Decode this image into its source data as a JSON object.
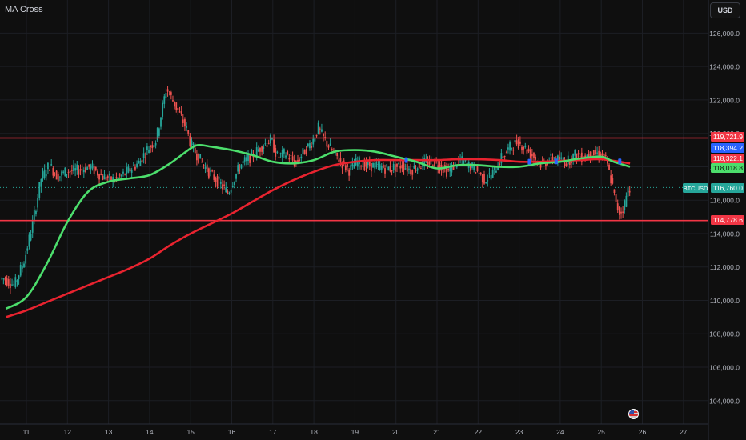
{
  "header": {
    "indicator_title": "MA Cross",
    "currency_label": "USD"
  },
  "colors": {
    "background": "#0f0f0f",
    "candle_up": "#26a69a",
    "candle_down": "#ef5350",
    "ma_fast": "#4cde6c",
    "ma_slow": "#e8232f",
    "level_line": "#f23645",
    "cross_marker": "#2962ff"
  },
  "chart_data": {
    "type": "candlestick",
    "symbol": "BTCUSD",
    "y_axis": {
      "range": [
        102600,
        127600
      ],
      "ticks": [
        104000,
        106000,
        108000,
        110000,
        112000,
        114000,
        116000,
        118000,
        120000,
        122000,
        124000,
        126000
      ],
      "tick_labels": [
        "104,000.0",
        "106,000.0",
        "108,000.0",
        "110,000.0",
        "112,000.0",
        "114,000.0",
        "116,000.0",
        "118,000.0",
        "120,000.0",
        "122,000.0",
        "124,000.0",
        "126,000.0"
      ]
    },
    "x_axis": {
      "ticks": [
        "11",
        "12",
        "13",
        "14",
        "15",
        "16",
        "17",
        "18",
        "19",
        "20",
        "21",
        "22",
        "23",
        "24",
        "25",
        "26",
        "27"
      ]
    },
    "horizontal_levels": [
      119721.9,
      114778.6
    ],
    "price_labels": [
      {
        "text": "119,721.9",
        "value": 119721.9,
        "color": "#f23645"
      },
      {
        "text": "118,394.2",
        "value": 118394.2,
        "color": "#2962ff"
      },
      {
        "text": "118,322.1",
        "value": 118322.1,
        "color": "#f23645"
      },
      {
        "text": "118,018.8",
        "value": 118018.8,
        "color": "#4cde6c"
      },
      {
        "text": "116,760.0",
        "value": 116760.0,
        "color": "#26a69a"
      },
      {
        "text": "114,778.6",
        "value": 114778.6,
        "color": "#f23645"
      }
    ],
    "last_price_label": "BTCUSD",
    "last_price": 116760.0,
    "price_path": [
      [
        10.5,
        111300
      ],
      [
        10.75,
        110900
      ],
      [
        11.0,
        112500
      ],
      [
        11.2,
        114700
      ],
      [
        11.4,
        117300
      ],
      [
        11.6,
        118100
      ],
      [
        11.8,
        117400
      ],
      [
        12.0,
        117700
      ],
      [
        12.3,
        117800
      ],
      [
        12.6,
        118000
      ],
      [
        12.9,
        117400
      ],
      [
        13.2,
        117200
      ],
      [
        13.5,
        117700
      ],
      [
        13.8,
        118300
      ],
      [
        14.0,
        119100
      ],
      [
        14.2,
        119600
      ],
      [
        14.35,
        121500
      ],
      [
        14.45,
        122700
      ],
      [
        14.6,
        122000
      ],
      [
        14.8,
        121000
      ],
      [
        14.95,
        120200
      ],
      [
        15.05,
        119300
      ],
      [
        15.2,
        118700
      ],
      [
        15.35,
        118100
      ],
      [
        15.55,
        117500
      ],
      [
        15.75,
        117000
      ],
      [
        15.95,
        116400
      ],
      [
        16.1,
        117300
      ],
      [
        16.25,
        118100
      ],
      [
        16.4,
        118400
      ],
      [
        16.6,
        118800
      ],
      [
        16.8,
        119300
      ],
      [
        17.0,
        119600
      ],
      [
        17.15,
        118600
      ],
      [
        17.35,
        118800
      ],
      [
        17.6,
        118200
      ],
      [
        17.8,
        118900
      ],
      [
        18.0,
        119500
      ],
      [
        18.15,
        120300
      ],
      [
        18.3,
        119600
      ],
      [
        18.5,
        118900
      ],
      [
        18.7,
        118300
      ],
      [
        18.9,
        117800
      ],
      [
        19.1,
        118300
      ],
      [
        19.3,
        118100
      ],
      [
        19.6,
        118000
      ],
      [
        19.9,
        117900
      ],
      [
        20.2,
        118100
      ],
      [
        20.4,
        117800
      ],
      [
        20.7,
        118200
      ],
      [
        21.0,
        118300
      ],
      [
        21.3,
        117700
      ],
      [
        21.6,
        118400
      ],
      [
        21.8,
        118100
      ],
      [
        22.0,
        117800
      ],
      [
        22.2,
        117200
      ],
      [
        22.4,
        117600
      ],
      [
        22.6,
        118500
      ],
      [
        22.8,
        119100
      ],
      [
        23.0,
        119500
      ],
      [
        23.2,
        119100
      ],
      [
        23.4,
        118600
      ],
      [
        23.6,
        118100
      ],
      [
        23.8,
        118500
      ],
      [
        24.0,
        118400
      ],
      [
        24.2,
        118300
      ],
      [
        24.4,
        118700
      ],
      [
        24.6,
        118600
      ],
      [
        24.8,
        118800
      ],
      [
        25.0,
        118800
      ],
      [
        25.15,
        118400
      ],
      [
        25.3,
        117000
      ],
      [
        25.4,
        115700
      ],
      [
        25.5,
        115200
      ],
      [
        25.6,
        115700
      ],
      [
        25.7,
        116760
      ]
    ],
    "series": [
      {
        "name": "MA fast",
        "points": [
          [
            10.5,
            109500
          ],
          [
            11.0,
            110200
          ],
          [
            11.5,
            112200
          ],
          [
            12.0,
            114700
          ],
          [
            12.5,
            116500
          ],
          [
            13.0,
            117100
          ],
          [
            13.5,
            117300
          ],
          [
            14.0,
            117500
          ],
          [
            14.5,
            118200
          ],
          [
            15.0,
            119100
          ],
          [
            15.2,
            119300
          ],
          [
            15.5,
            119200
          ],
          [
            16.0,
            119000
          ],
          [
            16.5,
            118700
          ],
          [
            17.0,
            118300
          ],
          [
            17.5,
            118200
          ],
          [
            18.0,
            118400
          ],
          [
            18.5,
            118900
          ],
          [
            19.0,
            119000
          ],
          [
            19.5,
            118900
          ],
          [
            20.0,
            118600
          ],
          [
            20.5,
            118300
          ],
          [
            21.0,
            117900
          ],
          [
            21.5,
            118100
          ],
          [
            22.0,
            118100
          ],
          [
            22.5,
            118000
          ],
          [
            23.0,
            118000
          ],
          [
            23.5,
            118200
          ],
          [
            24.0,
            118300
          ],
          [
            24.5,
            118500
          ],
          [
            25.0,
            118600
          ],
          [
            25.3,
            118300
          ],
          [
            25.7,
            118000
          ]
        ]
      },
      {
        "name": "MA slow",
        "points": [
          [
            10.5,
            109000
          ],
          [
            11.0,
            109400
          ],
          [
            11.5,
            109900
          ],
          [
            12.0,
            110400
          ],
          [
            12.5,
            110900
          ],
          [
            13.0,
            111400
          ],
          [
            13.5,
            111900
          ],
          [
            14.0,
            112500
          ],
          [
            14.5,
            113300
          ],
          [
            15.0,
            114000
          ],
          [
            15.5,
            114600
          ],
          [
            16.0,
            115200
          ],
          [
            16.5,
            115900
          ],
          [
            17.0,
            116600
          ],
          [
            17.5,
            117200
          ],
          [
            18.0,
            117700
          ],
          [
            18.5,
            118100
          ],
          [
            19.0,
            118300
          ],
          [
            19.5,
            118400
          ],
          [
            20.0,
            118400
          ],
          [
            20.5,
            118400
          ],
          [
            21.0,
            118400
          ],
          [
            21.5,
            118450
          ],
          [
            22.0,
            118450
          ],
          [
            22.5,
            118400
          ],
          [
            23.0,
            118300
          ],
          [
            23.5,
            118300
          ],
          [
            24.0,
            118350
          ],
          [
            24.5,
            118400
          ],
          [
            25.0,
            118450
          ],
          [
            25.7,
            118200
          ]
        ]
      }
    ],
    "cross_markers": [
      [
        20.25,
        118400
      ],
      [
        23.25,
        118300
      ],
      [
        23.9,
        118320
      ],
      [
        25.45,
        118320
      ]
    ]
  }
}
